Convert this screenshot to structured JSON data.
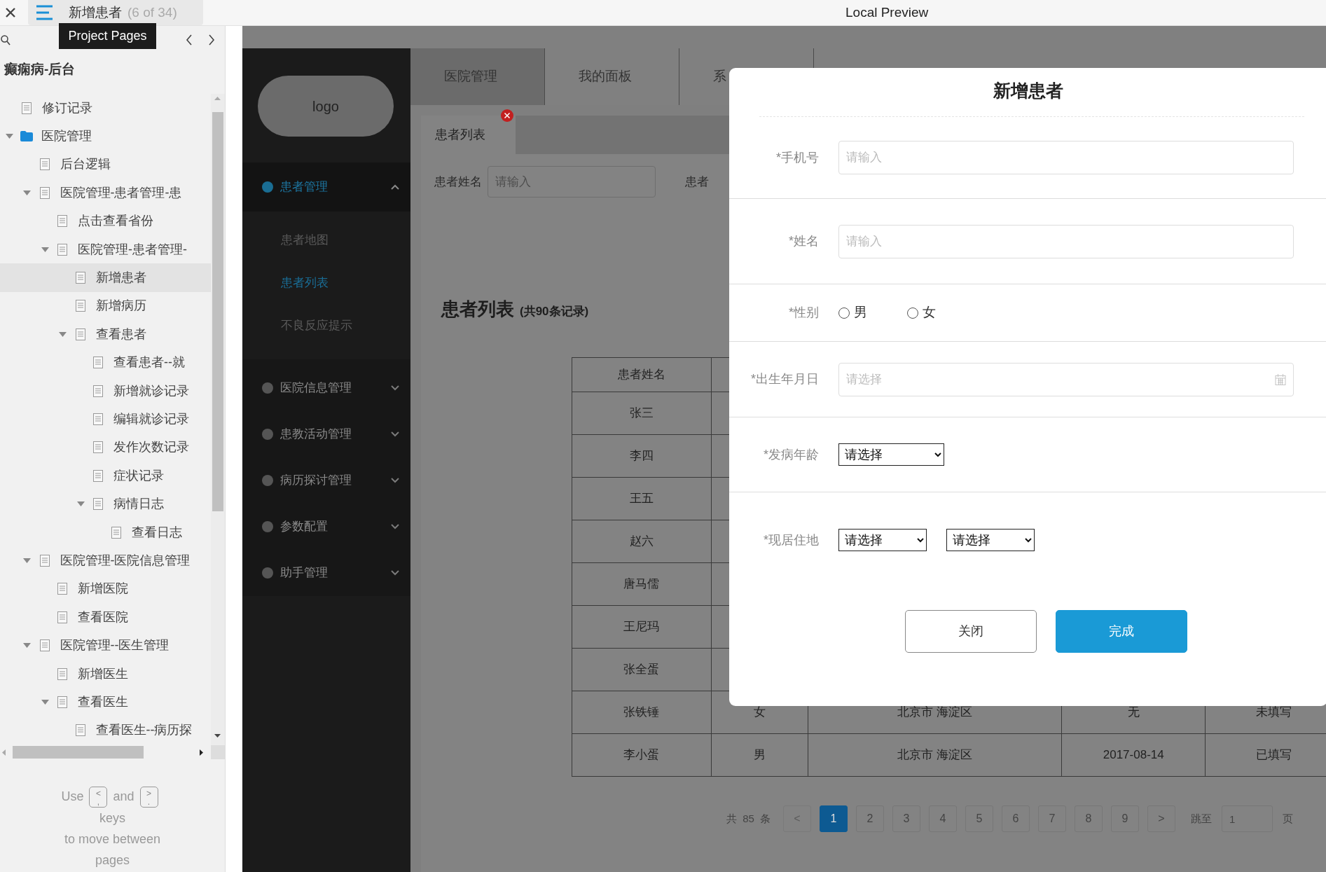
{
  "topbar": {
    "page_title": "新增患者",
    "page_count": "(6 of 34)",
    "window_title": "Local Preview"
  },
  "sidebar": {
    "tooltip": "Project Pages",
    "project": "癫痫病-后台",
    "tree": [
      {
        "label": "修订记录",
        "kind": "page",
        "selected": false
      },
      {
        "label": "医院管理",
        "kind": "folder",
        "selected": false,
        "expanded": true,
        "children": [
          {
            "label": "后台逻辑",
            "kind": "page",
            "selected": false
          },
          {
            "label": "医院管理-患者管理-患",
            "kind": "page",
            "selected": false,
            "expanded": true,
            "children": [
              {
                "label": "点击查看省份",
                "kind": "page",
                "selected": false
              },
              {
                "label": "医院管理-患者管理-",
                "kind": "page",
                "selected": false,
                "expanded": true,
                "children": [
                  {
                    "label": "新增患者",
                    "kind": "page",
                    "selected": true
                  },
                  {
                    "label": "新增病历",
                    "kind": "page",
                    "selected": false
                  },
                  {
                    "label": "查看患者",
                    "kind": "page",
                    "selected": false,
                    "expanded": true,
                    "children": [
                      {
                        "label": "查看患者--就",
                        "kind": "page",
                        "selected": false
                      },
                      {
                        "label": "新增就诊记录",
                        "kind": "page",
                        "selected": false
                      },
                      {
                        "label": "编辑就诊记录",
                        "kind": "page",
                        "selected": false
                      },
                      {
                        "label": "发作次数记录",
                        "kind": "page",
                        "selected": false
                      },
                      {
                        "label": "症状记录",
                        "kind": "page",
                        "selected": false
                      },
                      {
                        "label": "病情日志",
                        "kind": "page",
                        "selected": false,
                        "expanded": true,
                        "children": [
                          {
                            "label": "查看日志",
                            "kind": "page",
                            "selected": false
                          }
                        ]
                      }
                    ]
                  }
                ]
              }
            ]
          },
          {
            "label": "医院管理-医院信息管理",
            "kind": "page",
            "selected": false,
            "expanded": true,
            "children": [
              {
                "label": "新增医院",
                "kind": "page",
                "selected": false
              },
              {
                "label": "查看医院",
                "kind": "page",
                "selected": false
              }
            ]
          },
          {
            "label": "医院管理--医生管理",
            "kind": "page",
            "selected": false,
            "expanded": true,
            "children": [
              {
                "label": "新增医生",
                "kind": "page",
                "selected": false
              },
              {
                "label": "查看医生",
                "kind": "page",
                "selected": false,
                "expanded": true,
                "children": [
                  {
                    "label": "查看医生--病历探",
                    "kind": "page",
                    "selected": false
                  }
                ]
              }
            ]
          }
        ]
      }
    ],
    "help": {
      "use": "Use",
      "prev_key": "<\n,",
      "and": "and",
      "next_key": ">\n.",
      "keys": "keys",
      "line2": "to move between",
      "line3": "pages"
    }
  },
  "app": {
    "logo": "logo",
    "menu": [
      {
        "label": "患者管理",
        "selected": true,
        "expanded": true,
        "children": [
          {
            "label": "患者地图",
            "selected": false
          },
          {
            "label": "患者列表",
            "selected": true
          },
          {
            "label": "不良反应提示",
            "selected": false
          }
        ]
      },
      {
        "label": "医院信息管理",
        "selected": false,
        "expanded": false
      },
      {
        "label": "患教活动管理",
        "selected": false,
        "expanded": false
      },
      {
        "label": "病历探讨管理",
        "selected": false,
        "expanded": false
      },
      {
        "label": "参数配置",
        "selected": false,
        "expanded": false
      },
      {
        "label": "助手管理",
        "selected": false,
        "expanded": false
      }
    ],
    "top_tabs": [
      {
        "label": "医院管理",
        "selected": true
      },
      {
        "label": "我的面板",
        "selected": false
      },
      {
        "label": "系",
        "selected": false
      }
    ],
    "page_tabs": [
      {
        "label": "患者列表",
        "selected": true
      }
    ],
    "filters": [
      {
        "label": "患者姓名",
        "placeholder": "请输入"
      },
      {
        "label": "患者"
      }
    ],
    "list_title": "患者列表",
    "list_count": "(共90条记录)",
    "table": {
      "columns": [
        "患者姓名"
      ],
      "rows": [
        [
          "张三"
        ],
        [
          "李四"
        ],
        [
          "王五"
        ],
        [
          "赵六"
        ],
        [
          "唐马儒"
        ],
        [
          "王尼玛"
        ],
        [
          "张全蛋"
        ],
        [
          "张铁锤",
          "女",
          "北京市 海淀区",
          "无",
          "未填写"
        ],
        [
          "李小蛋",
          "男",
          "北京市 海淀区",
          "2017-08-14",
          "已填写"
        ]
      ]
    },
    "pagination": {
      "total": "共 85 条",
      "prev": {
        "label": "<",
        "disabled": true
      },
      "pages": [
        {
          "label": "1",
          "selected": true
        },
        {
          "label": "2",
          "selected": false
        },
        {
          "label": "3",
          "selected": false
        },
        {
          "label": "4",
          "selected": false
        },
        {
          "label": "5",
          "selected": false
        },
        {
          "label": "6",
          "selected": false
        },
        {
          "label": "7",
          "selected": false
        },
        {
          "label": "8",
          "selected": false
        },
        {
          "label": "9",
          "selected": false
        }
      ],
      "next": {
        "label": ">",
        "disabled": false
      },
      "jump_label": "跳至",
      "jump_value": "1",
      "page_suffix": "页"
    }
  },
  "modal": {
    "title": "新增患者",
    "fields": [
      {
        "kind": "text",
        "label": "*手机号",
        "placeholder": "请输入"
      },
      {
        "kind": "text",
        "label": "*姓名",
        "placeholder": "请输入"
      },
      {
        "kind": "radio",
        "label": "*性别",
        "options": [
          {
            "label": "男",
            "checked": false
          },
          {
            "label": "女",
            "checked": false
          }
        ]
      },
      {
        "kind": "date",
        "label": "*出生年月日",
        "placeholder": "请选择"
      },
      {
        "kind": "select",
        "label": "*发病年龄",
        "selects": [
          "请选择"
        ]
      },
      {
        "kind": "select",
        "label": "*现居住地",
        "selects": [
          "请选择",
          "请选择"
        ]
      }
    ],
    "buttons": [
      {
        "label": "关闭",
        "kind": "secondary"
      },
      {
        "label": "完成",
        "kind": "primary"
      }
    ]
  }
}
